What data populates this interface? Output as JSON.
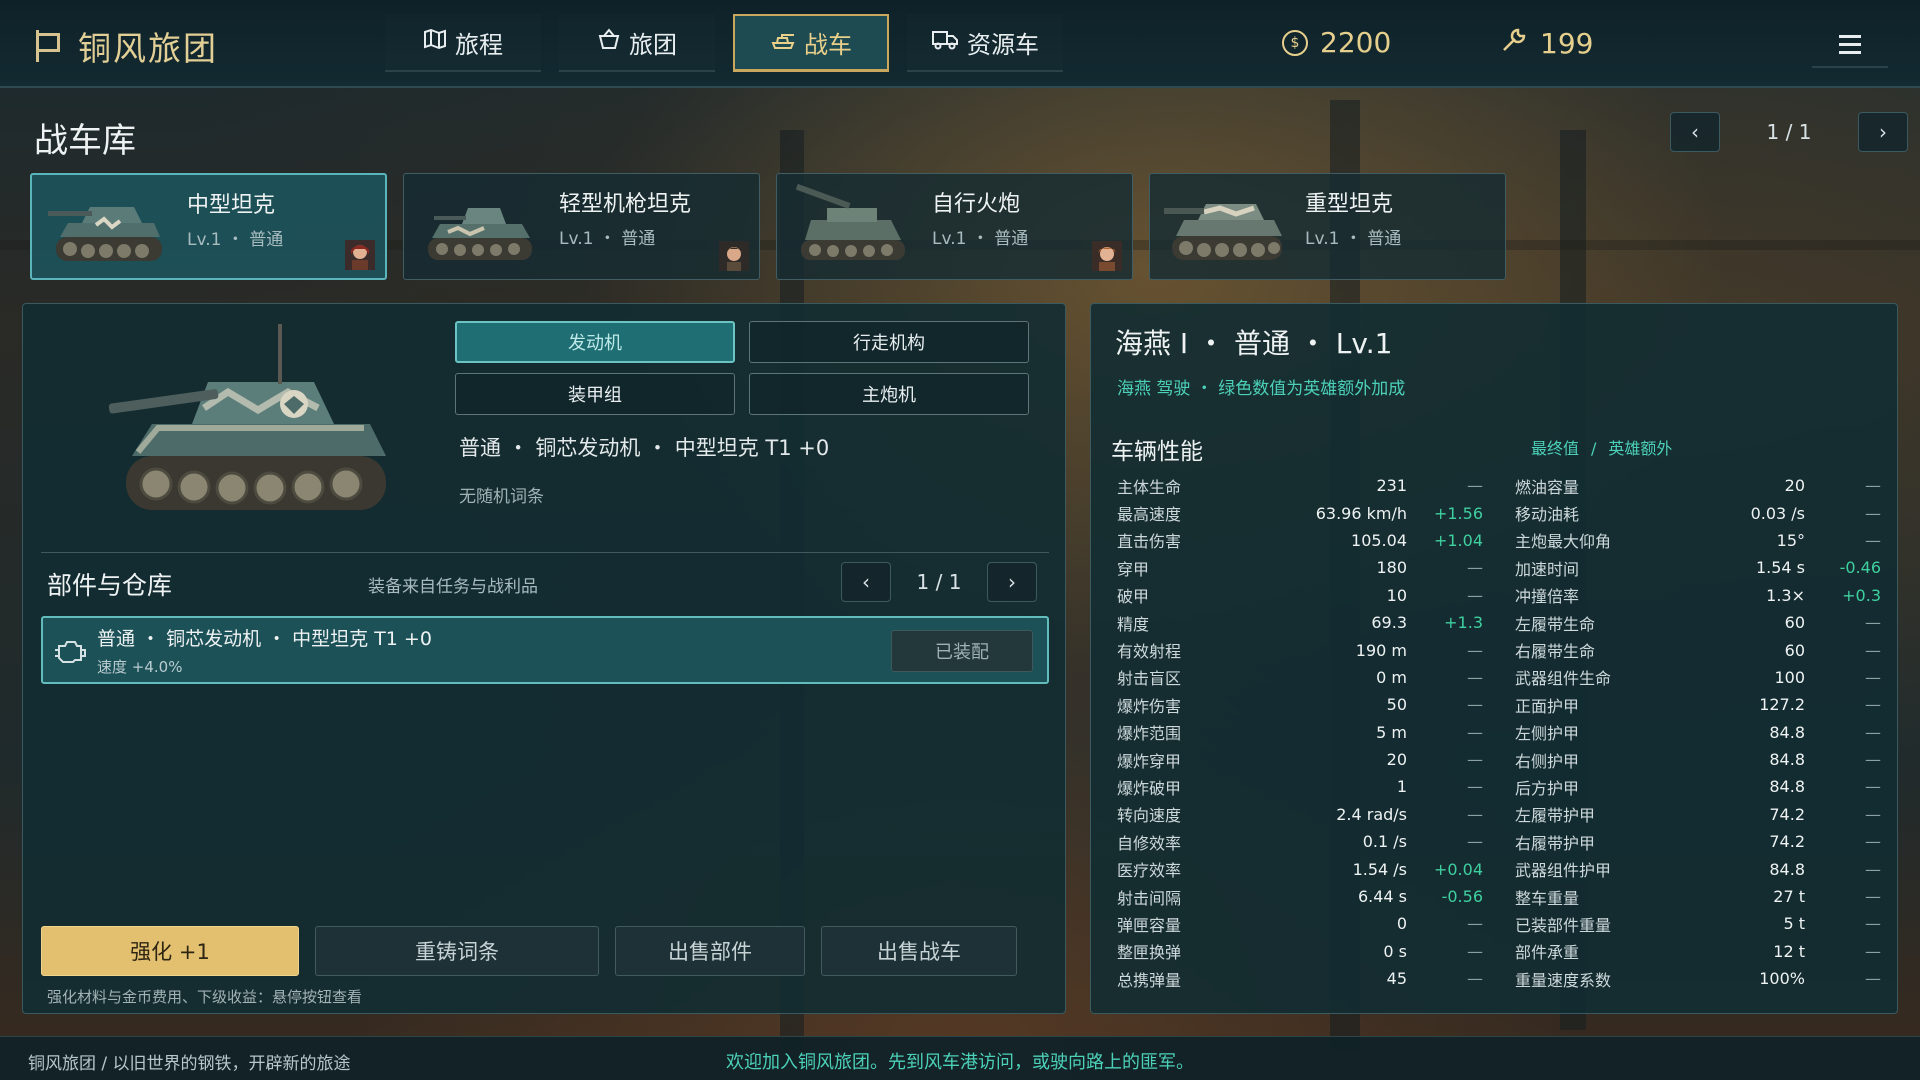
{
  "app": {
    "title": "铜风旅团"
  },
  "nav": {
    "tabs": [
      {
        "label": "旅程",
        "icon": "map-icon"
      },
      {
        "label": "旅团",
        "icon": "basket-icon"
      },
      {
        "label": "战车",
        "icon": "tank-icon",
        "active": true
      },
      {
        "label": "资源车",
        "icon": "truck-icon"
      }
    ]
  },
  "currency": {
    "gold": "2200",
    "parts": "199"
  },
  "garage": {
    "title": "战车库",
    "page": "1 / 1",
    "vehicles": [
      {
        "name": "中型坦克",
        "meta": "Lv.1 ・ 普通",
        "active": true,
        "has_pilot": true
      },
      {
        "name": "轻型机枪坦克",
        "meta": "Lv.1 ・ 普通",
        "active": false,
        "has_pilot": true
      },
      {
        "name": "自行火炮",
        "meta": "Lv.1 ・ 普通",
        "active": false,
        "has_pilot": true
      },
      {
        "name": "重型坦克",
        "meta": "Lv.1 ・ 普通",
        "active": false,
        "has_pilot": false
      }
    ]
  },
  "parts": {
    "tabs": [
      "发动机",
      "行走机构",
      "装甲组",
      "主炮机"
    ],
    "active_tab": 0,
    "current": "普通 ・ 铜芯发动机 ・ 中型坦克 T1 +0",
    "affix": "无随机词条"
  },
  "inventory": {
    "title": "部件与仓库",
    "subtitle": "装备来自任务与战利品",
    "page": "1 / 1",
    "items": [
      {
        "name": "普通 ・ 铜芯发动机 ・ 中型坦克 T1 +0",
        "stat": "速度 +4.0%",
        "button": "已装配"
      }
    ]
  },
  "actions": {
    "upgrade": "强化 +1",
    "reforge": "重铸词条",
    "sell_part": "出售部件",
    "sell_vehicle": "出售战车",
    "hint": "强化材料与金币费用、下级收益：悬停按钮查看"
  },
  "vehicle": {
    "title": "海燕 I ・ 普通 ・ Lv.1",
    "subtitle": "海燕 驾驶 ・ 绿色数值为英雄额外加成",
    "perf_title": "车辆性能",
    "legend_final": "最终值",
    "legend_sep": "/",
    "legend_hero": "英雄额外",
    "stats_left": [
      {
        "label": "主体生命",
        "value": "231",
        "bonus": "—"
      },
      {
        "label": "最高速度",
        "value": "63.96 km/h",
        "bonus": "+1.56"
      },
      {
        "label": "直击伤害",
        "value": "105.04",
        "bonus": "+1.04"
      },
      {
        "label": "穿甲",
        "value": "180",
        "bonus": "—"
      },
      {
        "label": "破甲",
        "value": "10",
        "bonus": "—"
      },
      {
        "label": "精度",
        "value": "69.3",
        "bonus": "+1.3"
      },
      {
        "label": "有效射程",
        "value": "190 m",
        "bonus": "—"
      },
      {
        "label": "射击盲区",
        "value": "0 m",
        "bonus": "—"
      },
      {
        "label": "爆炸伤害",
        "value": "50",
        "bonus": "—"
      },
      {
        "label": "爆炸范围",
        "value": "5 m",
        "bonus": "—"
      },
      {
        "label": "爆炸穿甲",
        "value": "20",
        "bonus": "—"
      },
      {
        "label": "爆炸破甲",
        "value": "1",
        "bonus": "—"
      },
      {
        "label": "转向速度",
        "value": "2.4 rad/s",
        "bonus": "—"
      },
      {
        "label": "自修效率",
        "value": "0.1 /s",
        "bonus": "—"
      },
      {
        "label": "医疗效率",
        "value": "1.54 /s",
        "bonus": "+0.04"
      },
      {
        "label": "射击间隔",
        "value": "6.44 s",
        "bonus": "-0.56"
      },
      {
        "label": "弹匣容量",
        "value": "0",
        "bonus": "—"
      },
      {
        "label": "整匣换弹",
        "value": "0 s",
        "bonus": "—"
      },
      {
        "label": "总携弹量",
        "value": "45",
        "bonus": "—"
      }
    ],
    "stats_right": [
      {
        "label": "燃油容量",
        "value": "20",
        "bonus": "—"
      },
      {
        "label": "移动油耗",
        "value": "0.03 /s",
        "bonus": "—"
      },
      {
        "label": "主炮最大仰角",
        "value": "15°",
        "bonus": "—"
      },
      {
        "label": "加速时间",
        "value": "1.54 s",
        "bonus": "-0.46"
      },
      {
        "label": "冲撞倍率",
        "value": "1.3×",
        "bonus": "+0.3"
      },
      {
        "label": "左履带生命",
        "value": "60",
        "bonus": "—"
      },
      {
        "label": "右履带生命",
        "value": "60",
        "bonus": "—"
      },
      {
        "label": "武器组件生命",
        "value": "100",
        "bonus": "—"
      },
      {
        "label": "正面护甲",
        "value": "127.2",
        "bonus": "—"
      },
      {
        "label": "左侧护甲",
        "value": "84.8",
        "bonus": "—"
      },
      {
        "label": "右侧护甲",
        "value": "84.8",
        "bonus": "—"
      },
      {
        "label": "后方护甲",
        "value": "84.8",
        "bonus": "—"
      },
      {
        "label": "左履带护甲",
        "value": "74.2",
        "bonus": "—"
      },
      {
        "label": "右履带护甲",
        "value": "74.2",
        "bonus": "—"
      },
      {
        "label": "武器组件护甲",
        "value": "84.8",
        "bonus": "—"
      },
      {
        "label": "整车重量",
        "value": "27 t",
        "bonus": "—"
      },
      {
        "label": "已装部件重量",
        "value": "5 t",
        "bonus": "—"
      },
      {
        "label": "部件承重",
        "value": "12 t",
        "bonus": "—"
      },
      {
        "label": "重量速度系数",
        "value": "100%",
        "bonus": "—"
      }
    ]
  },
  "status": {
    "left": "铜风旅团 / 以旧世界的钢铁，开辟新的旅途",
    "center": "欢迎加入铜风旅团。先到风车港访问，或驶向路上的匪军。"
  },
  "colors": {
    "accent": "#e3c070",
    "teal": "#4cd1b9",
    "panel": "#122c32"
  }
}
